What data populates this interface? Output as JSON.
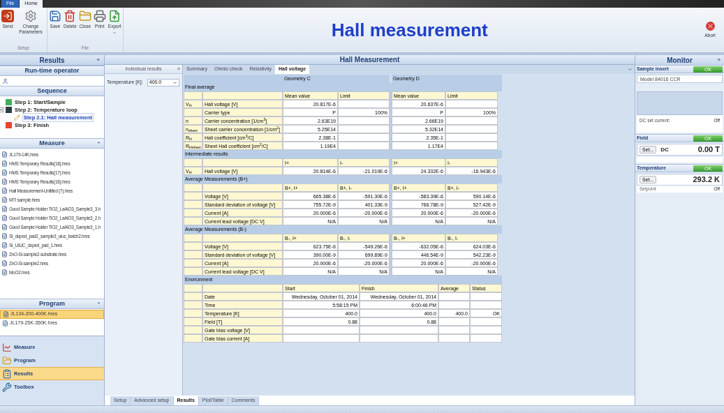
{
  "ribbon": {
    "tabs": [
      {
        "label": "File",
        "selected": false
      },
      {
        "label": "Home",
        "selected": true
      }
    ],
    "groups": [
      {
        "label": "Setup",
        "buttons": [
          {
            "label": "Send",
            "kind": "send"
          },
          {
            "label": "Change Parameters",
            "kind": "gear"
          }
        ]
      },
      {
        "label": "File",
        "buttons": [
          {
            "label": "Save",
            "kind": "save"
          },
          {
            "label": "Delete",
            "kind": "delete"
          },
          {
            "label": "Close",
            "kind": "close"
          },
          {
            "label": "Print",
            "kind": "print"
          },
          {
            "label": "Export",
            "kind": "export",
            "dropdown": true
          }
        ]
      }
    ],
    "title": "Hall measurement",
    "abort": "Abort"
  },
  "left": {
    "title": "Results",
    "collapse": "«",
    "runtime": "Run-time operator",
    "sequence_title": "Sequence",
    "sequence": [
      {
        "label": "Step 1: Start/Sample",
        "kind": "square",
        "color": "#3fae5a",
        "selected": false
      },
      {
        "label": "Step 2: Temperature loop",
        "kind": "square",
        "color": "#2f3f3f",
        "selected": false,
        "expanded": true,
        "children": [
          {
            "label": "Step 2.1: Hall measurement",
            "kind": "pencil",
            "selected": true
          }
        ]
      },
      {
        "label": "Step 3: Finish",
        "kind": "square",
        "color": "#e8452c",
        "selected": false
      }
    ],
    "measure_title": "Measure",
    "measure_toggle": "*",
    "measure": [
      {
        "label": "JL179-14K.hres"
      },
      {
        "label": "HMS Temporary Results(18).hres"
      },
      {
        "label": "HMS Temporary Results(17).hres"
      },
      {
        "label": "HMS Temporary Results(16).hres"
      },
      {
        "label": "Hall Measurement-Untitled (7).hres"
      },
      {
        "label": "MTI sample.hres"
      },
      {
        "label": "Good Sample Holder TiO2_LaAlO3_Sample3_3.h"
      },
      {
        "label": "Good Sample Holder TiO2_LaAlO3_Sample3_2.h"
      },
      {
        "label": "Good Sample Holder TiO2_LaAlO3_Sample3_1.h"
      },
      {
        "label": "Si_doped_pad2_sample3_uiuc_batch2.hres"
      },
      {
        "label": "Si_UIUC_doped_pad_1.hres"
      },
      {
        "label": "ZnO-Si-sample2-substrate.hres"
      },
      {
        "label": "ZnO-Si-sample2.hres"
      },
      {
        "label": "MoO2.hres"
      }
    ],
    "program_title": "Program",
    "program_toggle": "*",
    "program": [
      {
        "label": "JL134-200-400K.hres",
        "selected": true
      },
      {
        "label": "JL179-25K-350K.hres",
        "selected": false
      }
    ],
    "nav": [
      {
        "label": "Measure",
        "kind": "chart",
        "selected": false
      },
      {
        "label": "Program",
        "kind": "folder",
        "selected": false
      },
      {
        "label": "Results",
        "kind": "results",
        "selected": true
      },
      {
        "label": "Toolbox",
        "kind": "toolbox",
        "selected": false
      }
    ]
  },
  "center": {
    "title": "Hall Measurement",
    "side_title": "Individual results",
    "side_collapse": "«",
    "tabs": [
      {
        "label": "Summary",
        "selected": false
      },
      {
        "label": "Ohmic check",
        "selected": false
      },
      {
        "label": "Resistivity",
        "selected": false
      },
      {
        "label": "Hall voltage",
        "selected": true
      }
    ],
    "temperature_label": "Temperature [K]:",
    "temperature_value": "400.0",
    "geometries": [
      "Geometry C",
      "Geometry D"
    ],
    "sections": [
      {
        "title": "Final average",
        "kind": "grid",
        "heads": [
          [
            "Mean value",
            "Limit"
          ],
          [
            "Mean value",
            "Limit"
          ]
        ],
        "rows": [
          {
            "symbol": "V$_{H}$",
            "label": "Hall voltage [V]",
            "values": [
              {
                "first": "20.817E-6"
              },
              {
                "first": "20.637E-6"
              }
            ]
          },
          {
            "label": "Carrier type",
            "values": [
              {
                "first": "P",
                "second": "100%"
              },
              {
                "first": "P",
                "second": "100%"
              }
            ]
          },
          {
            "symbol": "n",
            "label": "Carrier concentration [1/cm$^{3}$]",
            "values": [
              {
                "first": "2.63E19"
              },
              {
                "first": "2.66E19"
              }
            ]
          },
          {
            "symbol": "n$_{sheet}$",
            "label": "Sheet carrier concentration [1/cm$^{2}$]",
            "values": [
              {
                "first": "5.25E14"
              },
              {
                "first": "5.32E14"
              }
            ]
          },
          {
            "symbol": "R$_{H}$",
            "label": "Hall coefficient [cm$^{3}$/C]",
            "values": [
              {
                "first": "2.38E-1"
              },
              {
                "first": "2.35E-1"
              }
            ]
          },
          {
            "symbol": "R$_{Hsheet}$",
            "label": "Sheet Hall coefficient [cm$^{2}$/C]",
            "values": [
              {
                "first": "1.19E4"
              },
              {
                "first": "1.17E4"
              }
            ]
          }
        ]
      },
      {
        "title": "Intermediate results",
        "kind": "grid",
        "heads": [
          [
            "I+",
            "I-"
          ],
          [
            "I+",
            "I-"
          ]
        ],
        "rows": [
          {
            "symbol": "V$_{H}$",
            "label": "Hall voltage [V]",
            "values": [
              {
                "first": "20.814E-6",
                "second": "-21.019E-6"
              },
              {
                "first": "24.332E-6",
                "second": "-16.943E-6"
              }
            ]
          }
        ]
      },
      {
        "title": "Average Measurements (B+)",
        "kind": "grid",
        "heads": [
          [
            "B+, I+",
            "B+, I-"
          ],
          [
            "B+, I+",
            "B+, I-"
          ]
        ],
        "rows": [
          {
            "label": "Voltage [V]",
            "values": [
              {
                "first": "665.38E-6",
                "second": "-591.30E-6"
              },
              {
                "first": "-583.39E-6",
                "second": "590.14E-6"
              }
            ]
          },
          {
            "label": "Standard deviation of voltage [V]",
            "values": [
              {
                "first": "755.72E-9",
                "second": "401.33E-9"
              },
              {
                "first": "766.78E-9",
                "second": "527.42E-9"
              }
            ]
          },
          {
            "label": "Current [A]",
            "values": [
              {
                "first": "20.000E-6",
                "second": "-20.000E-6"
              },
              {
                "first": "20.000E-6",
                "second": "-20.000E-6"
              }
            ]
          },
          {
            "label": "Current lead voltage [DC V]",
            "values": [
              {
                "first": "N/A",
                "second": "N/A"
              },
              {
                "first": "N/A",
                "second": "N/A"
              }
            ]
          }
        ]
      },
      {
        "title": "Average Measurements (B-)",
        "kind": "grid",
        "heads": [
          [
            "B-, I+",
            "B-, I-"
          ],
          [
            "B-, I+",
            "B-, I-"
          ]
        ],
        "rows": [
          {
            "label": "Voltage [V]",
            "values": [
              {
                "first": "623.75E-6",
                "second": "-549.26E-6"
              },
              {
                "first": "-632.05E-6",
                "second": "624.03E-6"
              }
            ]
          },
          {
            "label": "Standard deviation of voltage [V]",
            "values": [
              {
                "first": "390.00E-9",
                "second": "699.89E-9"
              },
              {
                "first": "446.54E-9",
                "second": "542.23E-9"
              }
            ]
          },
          {
            "label": "Current [A]",
            "values": [
              {
                "first": "20.000E-6",
                "second": "-20.000E-6"
              },
              {
                "first": "20.000E-6",
                "second": "-20.000E-6"
              }
            ]
          },
          {
            "label": "Current lead voltage [DC V]",
            "values": [
              {
                "first": "N/A",
                "second": "N/A"
              },
              {
                "first": "N/A",
                "second": "N/A"
              }
            ]
          }
        ]
      },
      {
        "title": "Environment",
        "kind": "environment",
        "heads": [
          "Start",
          "Finish",
          "Average",
          "Status"
        ],
        "rows": [
          {
            "label": "Date",
            "start": "Wednesday, October 01, 2014",
            "finish": "Wednesday, October 01, 2014"
          },
          {
            "label": "Time",
            "start": "5:58:15 PM",
            "finish": "6:00:46 PM"
          },
          {
            "label": "Temperature [K]",
            "start": "400.0",
            "finish": "400.0",
            "average": "400.0",
            "status": "OK"
          },
          {
            "label": "Field [T]",
            "start": "0.88",
            "finish": "0.88"
          },
          {
            "label": "Gate bias voltage [V]"
          },
          {
            "label": "Gate bias current [A]"
          }
        ]
      }
    ],
    "bottom_tabs": [
      {
        "label": "Setup",
        "selected": false
      },
      {
        "label": "Advanced setup",
        "selected": false
      },
      {
        "label": "Results",
        "selected": true
      },
      {
        "label": "Plot/Table",
        "selected": false
      },
      {
        "label": "Comments",
        "selected": false
      }
    ]
  },
  "monitor": {
    "title": "Monitor",
    "toggle": "»",
    "sample": {
      "title": "Sample insert",
      "status": "OK",
      "model": "Model 84016 CCR",
      "dc_label": "DC set current:",
      "dc_value": "Off"
    },
    "field": {
      "title": "Field",
      "status": "OK",
      "set": "Set...",
      "mode": "DC",
      "value": "0.00 T"
    },
    "temperature": {
      "title": "Temperature",
      "status": "OK",
      "set": "Set...",
      "value": "293.2 K",
      "setpoint_label": "Setpoint",
      "setpoint_value": "Off"
    }
  }
}
